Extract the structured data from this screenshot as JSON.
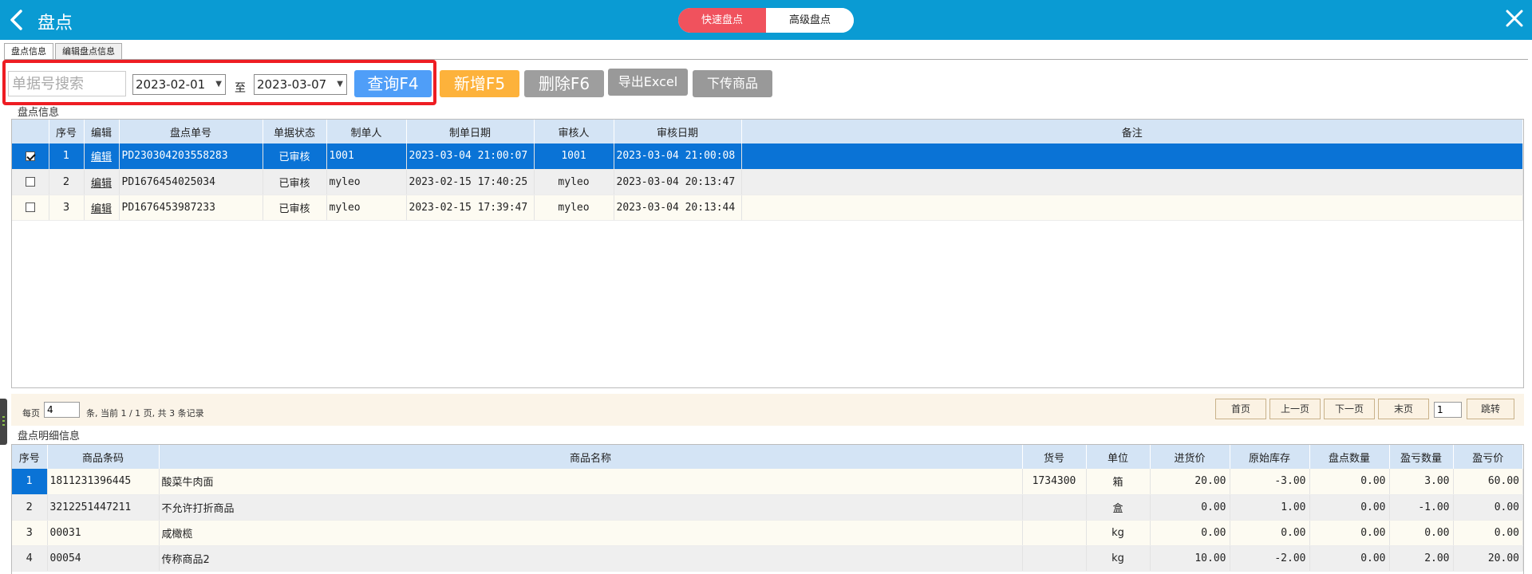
{
  "header": {
    "title": "盘点",
    "modes": [
      "快速盘点",
      "高级盘点"
    ],
    "active_mode": "快速盘点"
  },
  "tabs": [
    "盘点信息",
    "编辑盘点信息"
  ],
  "toolbar": {
    "search_placeholder": "单据号搜索",
    "date_from": "2023-02-01",
    "to_label": "至",
    "date_to": "2023-03-07",
    "query_label": "查询F4",
    "add_label": "新增F5",
    "delete_label": "删除F6",
    "export_label": "导出Excel",
    "upload_label": "下传商品"
  },
  "orders": {
    "section_label": "盘点信息",
    "columns": [
      "序号",
      "编辑",
      "盘点单号",
      "单据状态",
      "制单人",
      "制单日期",
      "审核人",
      "审核日期",
      "备注"
    ],
    "rows": [
      {
        "checked": true,
        "index": "1",
        "edit": "编辑",
        "no": "PD230304203558283",
        "status": "已审核",
        "maker": "1001",
        "make_date": "2023-03-04 21:00:07",
        "auditor": "1001",
        "audit_date": "2023-03-04 21:00:08",
        "note": ""
      },
      {
        "checked": false,
        "index": "2",
        "edit": "编辑",
        "no": "PD1676454025034",
        "status": "已审核",
        "maker": "myleo",
        "make_date": "2023-02-15 17:40:25",
        "auditor": "myleo",
        "audit_date": "2023-03-04 20:13:47",
        "note": ""
      },
      {
        "checked": false,
        "index": "3",
        "edit": "编辑",
        "no": "PD1676453987233",
        "status": "已审核",
        "maker": "myleo",
        "make_date": "2023-02-15 17:39:47",
        "auditor": "myleo",
        "audit_date": "2023-03-04 20:13:44",
        "note": ""
      }
    ]
  },
  "pager": {
    "per_page_label": "每页",
    "per_page_value": "4",
    "summary": "条, 当前 1 / 1 页, 共 3 条记录",
    "first": "首页",
    "prev": "上一页",
    "next": "下一页",
    "last": "末页",
    "page_value": "1",
    "jump": "跳转"
  },
  "details": {
    "section_label": "盘点明细信息",
    "columns": [
      "序号",
      "商品条码",
      "商品名称",
      "货号",
      "单位",
      "进货价",
      "原始库存",
      "盘点数量",
      "盈亏数量",
      "盈亏价"
    ],
    "rows": [
      {
        "index": "1",
        "barcode": "1811231396445",
        "name": "酸菜牛肉面",
        "item_no": "1734300",
        "unit": "箱",
        "cost": "20.00",
        "stock": "-3.00",
        "count": "0.00",
        "diff": "3.00",
        "diff_price": "60.00"
      },
      {
        "index": "2",
        "barcode": "3212251447211",
        "name": "不允许打折商品",
        "item_no": "",
        "unit": "盒",
        "cost": "0.00",
        "stock": "1.00",
        "count": "0.00",
        "diff": "-1.00",
        "diff_price": "0.00"
      },
      {
        "index": "3",
        "barcode": "00031",
        "name": "咸橄榄",
        "item_no": "",
        "unit": "kg",
        "cost": "0.00",
        "stock": "0.00",
        "count": "0.00",
        "diff": "0.00",
        "diff_price": "0.00"
      },
      {
        "index": "4",
        "barcode": "00054",
        "name": "传称商品2",
        "item_no": "",
        "unit": "kg",
        "cost": "10.00",
        "stock": "-2.00",
        "count": "0.00",
        "diff": "2.00",
        "diff_price": "20.00"
      }
    ]
  },
  "colors": {
    "titlebar": "#0a9bd3",
    "active_mode": "#f0525d",
    "query_button": "#4f9ef8",
    "add_button": "#fdb23b",
    "gray_button": "#9e9e9e",
    "selected_row": "#0a73d6",
    "header_row": "#d4e4f5",
    "highlight_box": "#ee1d23"
  }
}
